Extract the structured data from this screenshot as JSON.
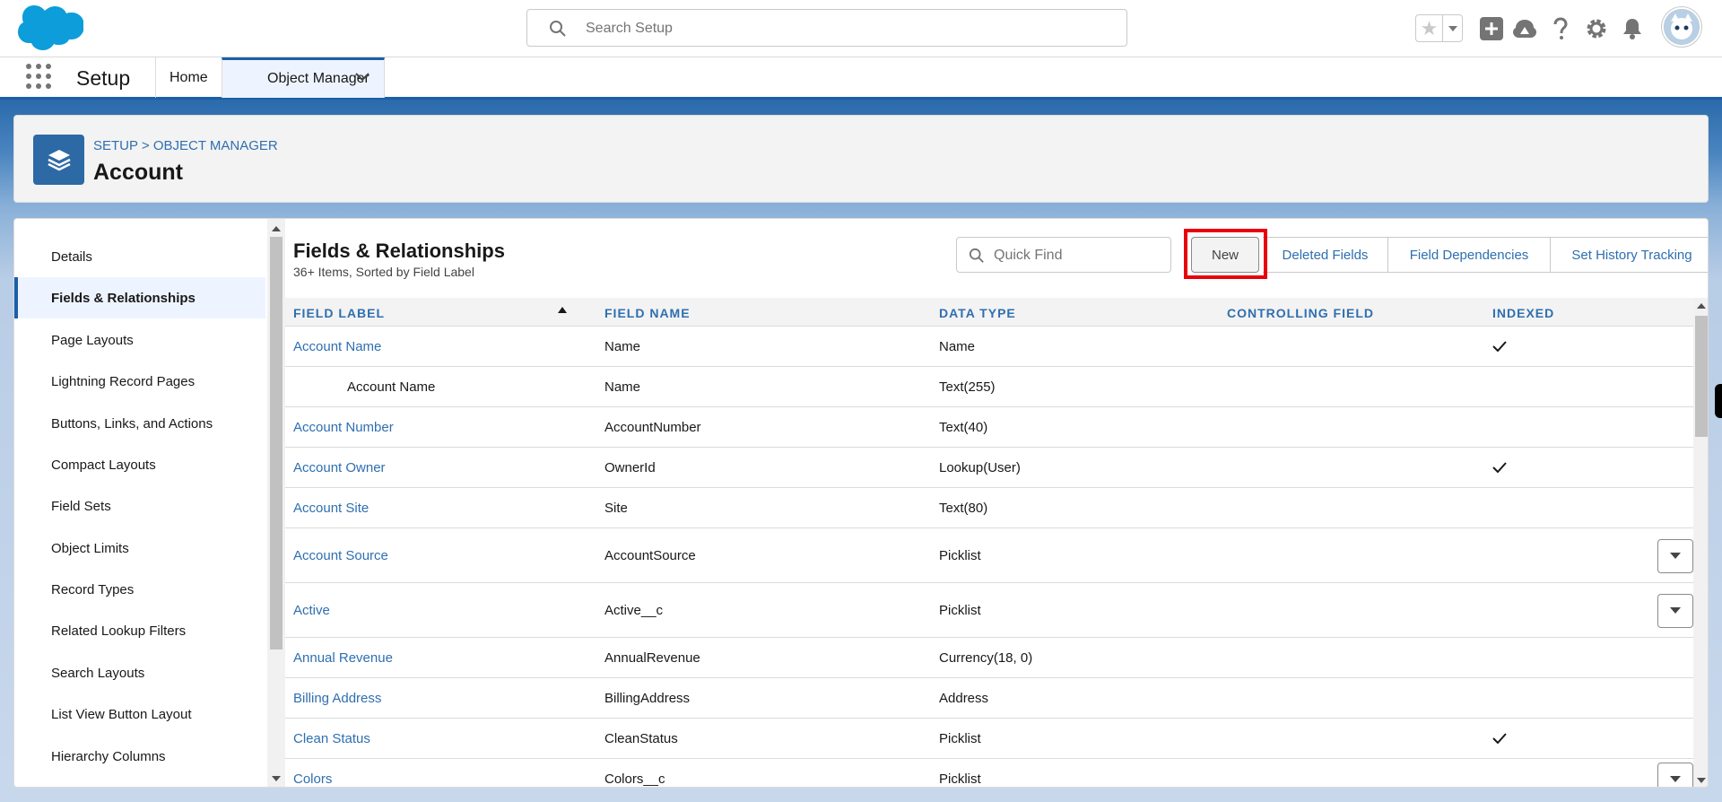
{
  "header": {
    "search_placeholder": "Search Setup"
  },
  "app_nav": {
    "app_name": "Setup",
    "tabs": [
      {
        "label": "Home"
      },
      {
        "label": "Object Manager"
      }
    ]
  },
  "page_header": {
    "breadcrumb": "SETUP > OBJECT MANAGER",
    "title": "Account"
  },
  "sidebar": {
    "items": [
      {
        "label": "Details"
      },
      {
        "label": "Fields & Relationships"
      },
      {
        "label": "Page Layouts"
      },
      {
        "label": "Lightning Record Pages"
      },
      {
        "label": "Buttons, Links, and Actions"
      },
      {
        "label": "Compact Layouts"
      },
      {
        "label": "Field Sets"
      },
      {
        "label": "Object Limits"
      },
      {
        "label": "Record Types"
      },
      {
        "label": "Related Lookup Filters"
      },
      {
        "label": "Search Layouts"
      },
      {
        "label": "List View Button Layout"
      },
      {
        "label": "Hierarchy Columns"
      }
    ],
    "active_index": 1
  },
  "main": {
    "title": "Fields & Relationships",
    "subtitle": "36+ Items, Sorted by Field Label",
    "quick_find_placeholder": "Quick Find",
    "buttons": {
      "new": "New",
      "deleted_fields": "Deleted Fields",
      "field_dependencies": "Field Dependencies",
      "set_history_tracking": "Set History Tracking"
    },
    "columns": [
      "FIELD LABEL",
      "FIELD NAME",
      "DATA TYPE",
      "CONTROLLING FIELD",
      "INDEXED"
    ],
    "rows": [
      {
        "label": "Account Name",
        "name": "Name",
        "type": "Name",
        "controlling": "",
        "indexed": true,
        "menu": false
      },
      {
        "label": "Account Name",
        "name": "Name",
        "type": "Text(255)",
        "controlling": "",
        "indexed": false,
        "menu": false,
        "sub": true
      },
      {
        "label": "Account Number",
        "name": "AccountNumber",
        "type": "Text(40)",
        "controlling": "",
        "indexed": false,
        "menu": false
      },
      {
        "label": "Account Owner",
        "name": "OwnerId",
        "type": "Lookup(User)",
        "controlling": "",
        "indexed": true,
        "menu": false
      },
      {
        "label": "Account Site",
        "name": "Site",
        "type": "Text(80)",
        "controlling": "",
        "indexed": false,
        "menu": false
      },
      {
        "label": "Account Source",
        "name": "AccountSource",
        "type": "Picklist",
        "controlling": "",
        "indexed": false,
        "menu": true
      },
      {
        "label": "Active",
        "name": "Active__c",
        "type": "Picklist",
        "controlling": "",
        "indexed": false,
        "menu": true
      },
      {
        "label": "Annual Revenue",
        "name": "AnnualRevenue",
        "type": "Currency(18, 0)",
        "controlling": "",
        "indexed": false,
        "menu": false
      },
      {
        "label": "Billing Address",
        "name": "BillingAddress",
        "type": "Address",
        "controlling": "",
        "indexed": false,
        "menu": false
      },
      {
        "label": "Clean Status",
        "name": "CleanStatus",
        "type": "Picklist",
        "controlling": "",
        "indexed": true,
        "menu": false
      },
      {
        "label": "Colors",
        "name": "Colors__c",
        "type": "Picklist",
        "controlling": "",
        "indexed": false,
        "menu": true
      }
    ]
  }
}
